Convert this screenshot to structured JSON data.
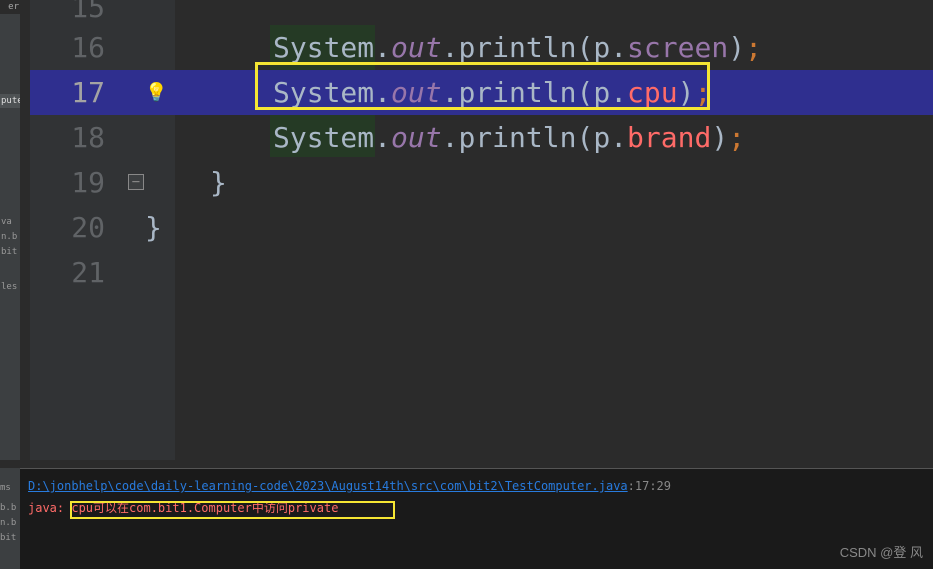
{
  "editor": {
    "lines": [
      {
        "n": "15",
        "code": ""
      },
      {
        "n": "16",
        "code": "System.out.println(p.screen);"
      },
      {
        "n": "17",
        "code": "System.out.println(p.cpu);"
      },
      {
        "n": "18",
        "code": "System.out.println(p.brand);"
      },
      {
        "n": "19",
        "code": "}"
      },
      {
        "n": "20",
        "code": "}"
      },
      {
        "n": "21",
        "code": ""
      }
    ],
    "current_line": 17,
    "bulb_icon": "💡",
    "fold_icon": "−",
    "tokens": {
      "system": "System",
      "dot": ".",
      "out": "out",
      "println": "println",
      "lparen": "(",
      "p": "p",
      "screen": "screen",
      "cpu": "cpu",
      "brand": "brand",
      "rparen": ")",
      "semi": ";",
      "brace": "}"
    }
  },
  "left_panel": {
    "tab_er": "er",
    "tab_puter": "puter",
    "item1": "va",
    "item2": "n.b",
    "item3": "bit",
    "item4": "les"
  },
  "console": {
    "path": "D:\\jonbhelp\\code\\daily-learning-code\\2023\\August14th\\src\\com\\bit2\\TestComputer.java",
    "location": ":17:29",
    "err_prefix": "java: ",
    "err_msg": "cpu可以在com.bit1.Computer中访问private",
    "left_items": [
      "ms",
      "b.b",
      "n.b",
      "bit"
    ]
  },
  "watermark": "CSDN @登 风"
}
